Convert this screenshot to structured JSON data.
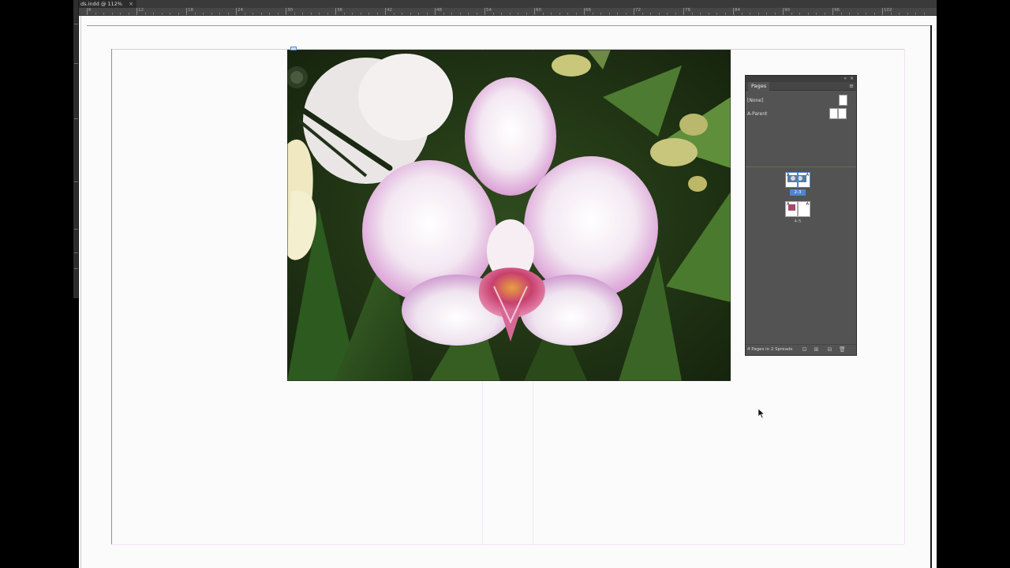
{
  "document": {
    "tab_title": "ds.indd @ 112%",
    "close_glyph": "×"
  },
  "ruler": {
    "labels": [
      "6",
      "12",
      "18",
      "24",
      "30",
      "36",
      "42",
      "48",
      "54",
      "60",
      "66",
      "72",
      "78",
      "84",
      "90",
      "96",
      "102"
    ]
  },
  "image": {
    "subject": "pink-white-orchid"
  },
  "pages_panel": {
    "tab_label": "Pages",
    "collapse_glyph": "«",
    "close_glyph": "×",
    "menu_glyph": "≡",
    "parents": [
      {
        "label": "[None]"
      },
      {
        "label": "A-Parent"
      }
    ],
    "spreads": [
      {
        "label": "2-3",
        "left_letter": "A",
        "right_letter": "A",
        "selected": true
      },
      {
        "label": "4-5",
        "left_letter": "A",
        "right_letter": "A",
        "selected": false
      }
    ],
    "footer_text": "4 Pages in 2 Spreads",
    "footer_icons": [
      "edit-page-size-icon",
      "new-page-icon",
      "new-page-icon",
      "delete-page-icon"
    ]
  },
  "colors": {
    "selection_blue": "#4a86d4",
    "margin_guide": "#b56fc4",
    "panel_bg": "#535353"
  }
}
